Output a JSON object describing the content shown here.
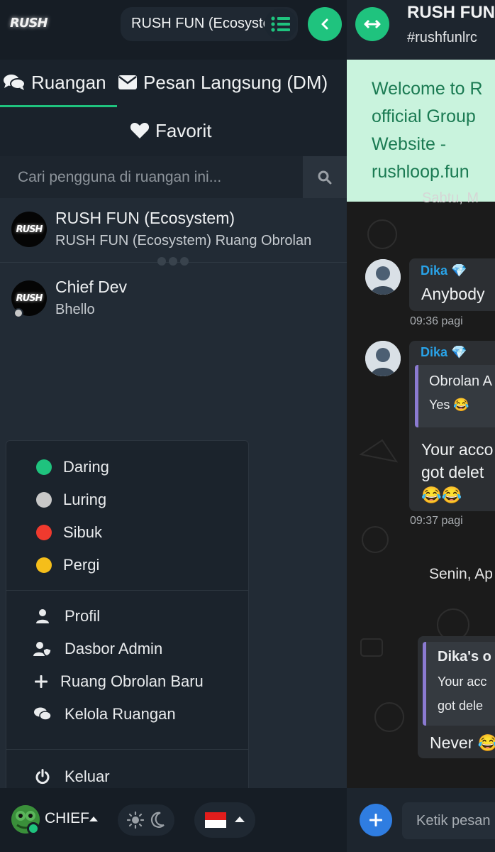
{
  "app": {
    "logo_text": "RUSH"
  },
  "header": {
    "room_selector": "RUSH FUN (Ecosystem)"
  },
  "tabs": [
    {
      "label": "Ruangan",
      "icon": "chat-bubbles-icon"
    },
    {
      "label": "Pesan Langsung (DM)",
      "icon": "envelope-icon"
    },
    {
      "label": "Favorit",
      "icon": "heart-icon"
    }
  ],
  "search": {
    "placeholder": "Cari pengguna di ruangan ini..."
  },
  "rooms": [
    {
      "name": "RUSH FUN (Ecosystem)",
      "subtitle": "RUSH FUN (Ecosystem) Ruang Obrolan",
      "avatar_text": "RUSH"
    },
    {
      "name": "Chief Dev",
      "subtitle": "Bhello",
      "avatar_text": "RUSH"
    }
  ],
  "status_menu": {
    "statuses": [
      {
        "label": "Daring",
        "color": "#1fc37e"
      },
      {
        "label": "Luring",
        "color": "#c8c8c8"
      },
      {
        "label": "Sibuk",
        "color": "#f03a2e"
      },
      {
        "label": "Pergi",
        "color": "#f5be1a"
      }
    ],
    "actions": [
      {
        "label": "Profil",
        "icon": "user-icon"
      },
      {
        "label": "Dasbor Admin",
        "icon": "user-shield-icon"
      },
      {
        "label": "Ruang Obrolan Baru",
        "icon": "plus-icon"
      },
      {
        "label": "Kelola Ruangan",
        "icon": "comments-icon"
      }
    ],
    "logout": {
      "label": "Keluar",
      "icon": "power-icon"
    }
  },
  "user": {
    "name": "CHIEF",
    "status_color": "#1fc37e"
  },
  "language": {
    "flag": "Indonesia"
  },
  "chat": {
    "title": "RUSH FUN",
    "channel": "#rushfunlrc",
    "welcome": "Welcome to R\nofficial Group\nWebsite -\nrushloop.fun",
    "date_top": "Sabtu, M",
    "messages": [
      {
        "sender": "Dika 💎",
        "text": "Anybody",
        "time": "09:36 pagi"
      },
      {
        "sender": "Dika 💎",
        "quote_name": "Obrolan A",
        "quote_text": "Yes 😂",
        "text_line1": "Your acco",
        "text_line2": "got delet",
        "text_line3": "😂😂",
        "time": "09:37 pagi"
      }
    ],
    "date_monday": "Senin, Ap",
    "reply_card": {
      "quote_name": "Dika's o",
      "quote_line1": "Your acc",
      "quote_line2": "got dele",
      "text": "Never 😂"
    },
    "composer_placeholder": "Ketik pesan"
  },
  "colors": {
    "accent": "#1fc37e",
    "panel": "#222b35",
    "blue_button": "#2f7de1"
  }
}
